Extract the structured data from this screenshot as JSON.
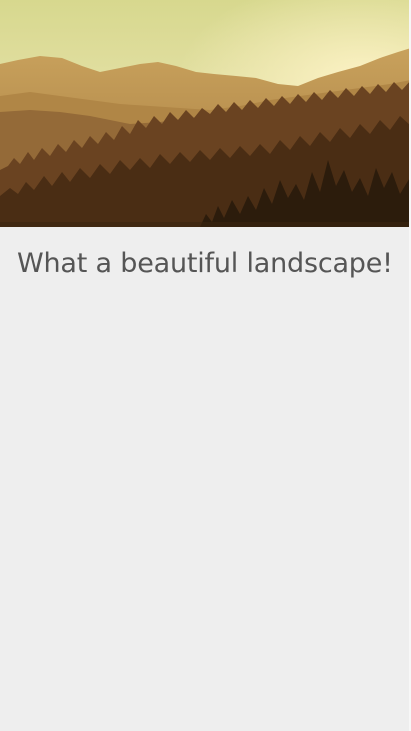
{
  "hero_image": {
    "subject": "mountain-landscape-image",
    "colors": {
      "sky_top": "#d8d98c",
      "sky_bottom": "#e9e6b0",
      "far_ridge": "#c59c55",
      "mid_ridge": "#a57a3f",
      "near_hills": "#8b6034",
      "forest": "#5a3618",
      "foreground_trees": "#2e1d0d"
    }
  },
  "caption": {
    "text": "What a beautiful landscape!"
  }
}
